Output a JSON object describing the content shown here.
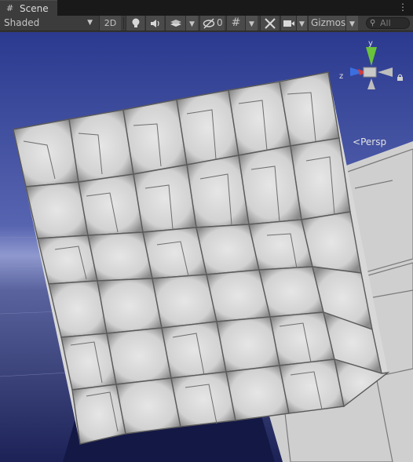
{
  "tab": {
    "label": "Scene",
    "icon": "grid-icon"
  },
  "toolbar": {
    "draw_mode": "Shaded",
    "btn_2d": "2D",
    "hidden_count": "0",
    "gizmos_label": "Gizmos",
    "search_placeholder": "All"
  },
  "gizmo": {
    "y_label": "y",
    "z_label": "z",
    "projection_label": "Persp"
  },
  "colors": {
    "sky_top": "#2b3a8f",
    "sky_horizon": "#7f8cc9",
    "axis_y": "#6ac33a",
    "axis_x": "#d43a3a",
    "axis_z": "#3b6fe0",
    "panel_face": "#e0e0e0"
  }
}
